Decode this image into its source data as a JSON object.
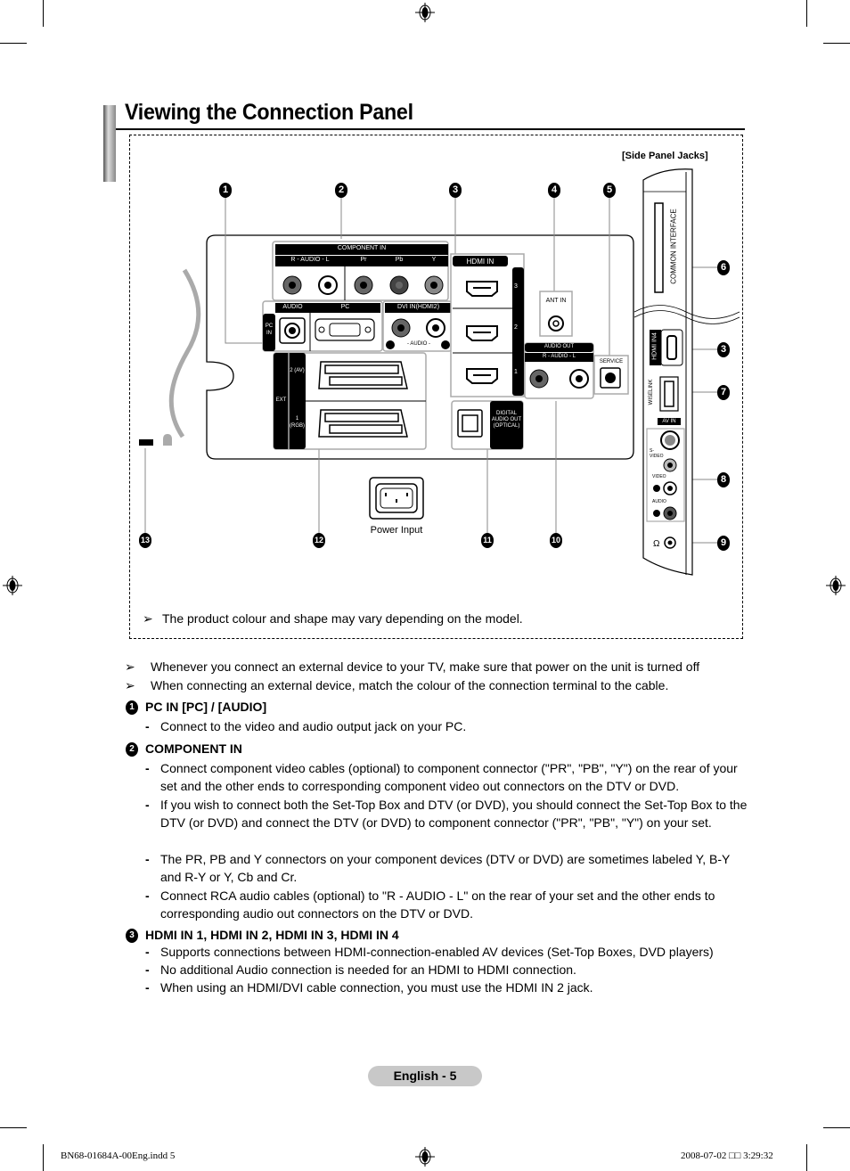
{
  "page": {
    "title": "Viewing the Connection Panel",
    "side_panel_label": "[Side Panel Jacks]",
    "figure_note": "The product colour and shape may vary depending on the model.",
    "page_number": "English - 5",
    "slug_left": "BN68-01684A-00Eng.indd   5",
    "slug_right": "2008-07-02   □□ 3:29:32"
  },
  "figure": {
    "callouts": [
      "1",
      "2",
      "3",
      "4",
      "5",
      "6",
      "3",
      "7",
      "8",
      "9",
      "10",
      "11",
      "12",
      "13"
    ],
    "labels": {
      "component_in": "COMPONENT IN",
      "audio_rl": "R - AUDIO - L",
      "pr": "Pr",
      "pb": "Pb",
      "y": "Y",
      "hdmi_in": "HDMI IN",
      "hdmi_ports": [
        "3",
        "2",
        "1"
      ],
      "ant_in": "ANT IN",
      "pc_in": "PC IN",
      "audio": "AUDIO",
      "pc": "PC",
      "dvi_in": "DVI IN(HDMI2)",
      "dvi_audio": "- AUDIO -",
      "audio_out": "AUDIO OUT",
      "service": "SERVICE",
      "ext": "EXT",
      "ext2": "2 (AV)",
      "ext1": "1 (RGB)",
      "digital_audio_out": "DIGITAL AUDIO OUT (OPTICAL)",
      "power_input": "Power Input",
      "common_interface": "COMMON INTERFACE",
      "hdmi_in4": "HDMI IN4",
      "wiselink": "WISELINK",
      "av_in": "AV IN",
      "s_video": "S-VIDEO",
      "video": "VIDEO",
      "audio_side": "AUDIO"
    }
  },
  "notes": [
    "Whenever you connect an external device to your TV, make sure that power on the unit is turned off",
    "When connecting an external device, match the colour of the connection terminal to the cable."
  ],
  "sections": [
    {
      "num": "1",
      "heading": "PC IN [PC] / [AUDIO]",
      "bullets": [
        "Connect to the video and audio output jack on your PC."
      ]
    },
    {
      "num": "2",
      "heading": "COMPONENT IN",
      "bullets": [
        "Connect component video cables (optional) to component connector (\"PR\", \"PB\", \"Y\") on the rear of your set and the other ends to corresponding component video out connectors on the DTV or DVD.",
        "If you wish to connect both the Set-Top Box and DTV (or DVD), you should connect the Set-Top Box to the DTV (or DVD) and connect the DTV (or DVD) to component connector (\"PR\", \"PB\", \"Y\") on your set.",
        "The PR, PB and Y connectors on your component devices (DTV or DVD) are sometimes labeled Y, B-Y and R-Y or Y, Cb and Cr.",
        "Connect RCA audio cables (optional) to \"R - AUDIO - L\" on the rear of your set and the other ends to corresponding audio out connectors on the DTV or DVD."
      ]
    },
    {
      "num": "3",
      "heading": "HDMI IN 1, HDMI IN 2, HDMI IN 3, HDMI IN 4",
      "bullets": [
        "Supports connections between HDMI-connection-enabled AV devices (Set-Top Boxes, DVD players)",
        "No additional Audio connection is needed for an HDMI to HDMI connection.",
        "When using an HDMI/DVI cable connection, you must use the HDMI IN 2 jack."
      ]
    }
  ]
}
